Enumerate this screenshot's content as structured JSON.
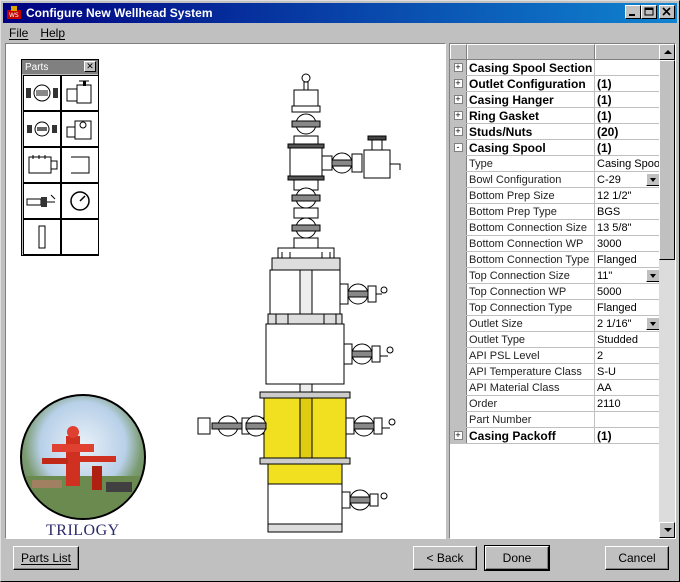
{
  "window": {
    "title": "Configure New Wellhead System"
  },
  "menu": {
    "items": [
      "File",
      "Help"
    ]
  },
  "palette": {
    "title": "Parts"
  },
  "logo": {
    "text": "TRILOGY"
  },
  "grid": {
    "rows": [
      {
        "type": "section",
        "label": "Casing Spool Section",
        "value": "",
        "expander": "+"
      },
      {
        "type": "section",
        "label": "Outlet Configuration",
        "value": "(1)",
        "expander": "+"
      },
      {
        "type": "section",
        "label": "Casing Hanger",
        "value": "(1)",
        "expander": "+"
      },
      {
        "type": "section",
        "label": "Ring Gasket",
        "value": "(1)",
        "expander": "+"
      },
      {
        "type": "section",
        "label": "Studs/Nuts",
        "value": "(20)",
        "expander": "+"
      },
      {
        "type": "section",
        "label": "Casing Spool",
        "value": "(1)",
        "expander": "-"
      },
      {
        "type": "prop",
        "label": "Type",
        "value": "Casing Spool",
        "combo": false
      },
      {
        "type": "prop",
        "label": "Bowl Configuration",
        "value": "C-29",
        "combo": true
      },
      {
        "type": "prop",
        "label": "Bottom Prep Size",
        "value": "12 1/2\"",
        "combo": false
      },
      {
        "type": "prop",
        "label": "Bottom Prep Type",
        "value": "BGS",
        "combo": false
      },
      {
        "type": "prop",
        "label": "Bottom Connection Size",
        "value": "13 5/8\"",
        "combo": false
      },
      {
        "type": "prop",
        "label": "Bottom Connection WP",
        "value": "3000",
        "combo": false
      },
      {
        "type": "prop",
        "label": "Bottom Connection Type",
        "value": "Flanged",
        "combo": false
      },
      {
        "type": "prop",
        "label": "Top Connection Size",
        "value": "11\"",
        "combo": true
      },
      {
        "type": "prop",
        "label": "Top Connection WP",
        "value": "5000",
        "combo": false
      },
      {
        "type": "prop",
        "label": "Top Connection Type",
        "value": "Flanged",
        "combo": false
      },
      {
        "type": "prop",
        "label": "Outlet Size",
        "value": "2 1/16\"",
        "combo": true
      },
      {
        "type": "prop",
        "label": "Outlet Type",
        "value": "Studded",
        "combo": false
      },
      {
        "type": "prop",
        "label": "API PSL Level",
        "value": "2",
        "combo": false
      },
      {
        "type": "prop",
        "label": "API Temperature Class",
        "value": "S-U",
        "combo": false
      },
      {
        "type": "prop",
        "label": "API Material Class",
        "value": "AA",
        "combo": false
      },
      {
        "type": "prop",
        "label": "Order",
        "value": "2110",
        "combo": false
      },
      {
        "type": "prop",
        "label": "Part Number",
        "value": "",
        "combo": false
      },
      {
        "type": "section",
        "label": "Casing Packoff",
        "value": "(1)",
        "expander": "+"
      }
    ]
  },
  "buttons": {
    "parts_list": "Parts List",
    "back": "< Back",
    "done": "Done",
    "cancel": "Cancel"
  },
  "colors": {
    "titlebar_start": "#000080",
    "titlebar_end": "#1084d0",
    "highlight_part": "#f0e020"
  },
  "icons": [
    "app-icon",
    "minimize-icon",
    "maximize-icon",
    "close-icon",
    "plus-icon",
    "minus-icon",
    "combo-arrow-icon",
    "scroll-up-icon",
    "scroll-down-icon"
  ]
}
